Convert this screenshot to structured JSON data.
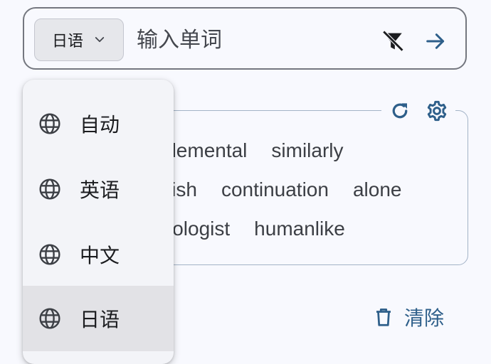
{
  "search": {
    "language_chip": "日语",
    "placeholder": "输入单词"
  },
  "words": {
    "row1": [
      "elemental",
      "similarly"
    ],
    "row2": [
      "ggish",
      "continuation",
      "alone"
    ],
    "row3": [
      "icologist",
      "humanlike"
    ]
  },
  "clear_label": "清除",
  "menu": {
    "items": [
      {
        "label": "自动",
        "icon": "globe-icon"
      },
      {
        "label": "英语",
        "icon": "globe-icon"
      },
      {
        "label": "中文",
        "icon": "globe-icon"
      },
      {
        "label": "日语",
        "icon": "globe-icon",
        "selected": true
      }
    ]
  },
  "colors": {
    "accent": "#2e5f8a",
    "background": "#f8f9fe",
    "menu_selected": "#e2e2e6"
  }
}
